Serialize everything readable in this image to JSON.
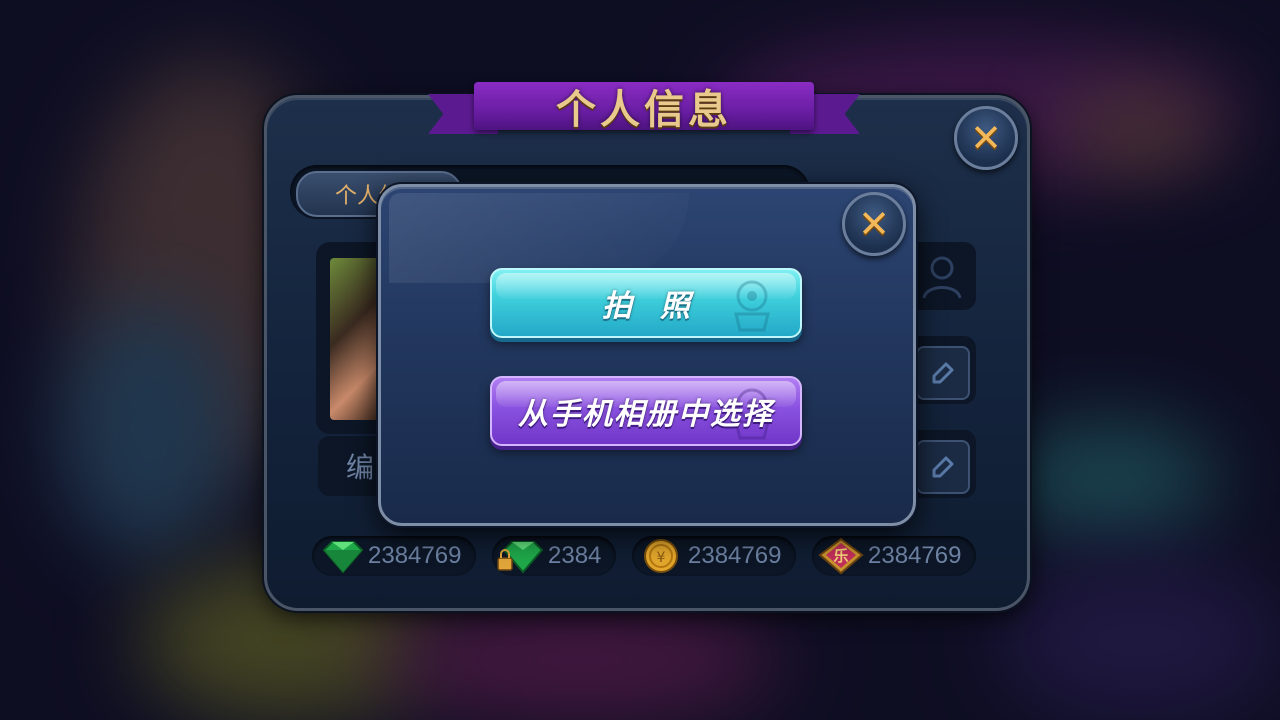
{
  "panel": {
    "title": "个人信息",
    "tabs": [
      {
        "label": "个人信息",
        "active": true
      },
      {
        "label": "",
        "active": false
      },
      {
        "label": "",
        "active": false
      }
    ],
    "edit_label": "编",
    "close_icon": "close-icon"
  },
  "currencies": [
    {
      "icon": "green-diamond-icon",
      "value": "2384769"
    },
    {
      "icon": "locked-diamond-icon",
      "value": "2384"
    },
    {
      "icon": "gold-coin-icon",
      "value": "2384769"
    },
    {
      "icon": "le-gem-icon",
      "value": "2384769",
      "icon_text": "乐"
    }
  ],
  "popup": {
    "take_photo_label": "拍照",
    "choose_album_label": "从手机相册中选择",
    "close_icon": "close-icon"
  },
  "colors": {
    "accent_gold": "#e9c98c",
    "ribbon_purple": "#6a1ea4",
    "photo_button": "#3fd0dc",
    "album_button": "#8a52e0"
  }
}
